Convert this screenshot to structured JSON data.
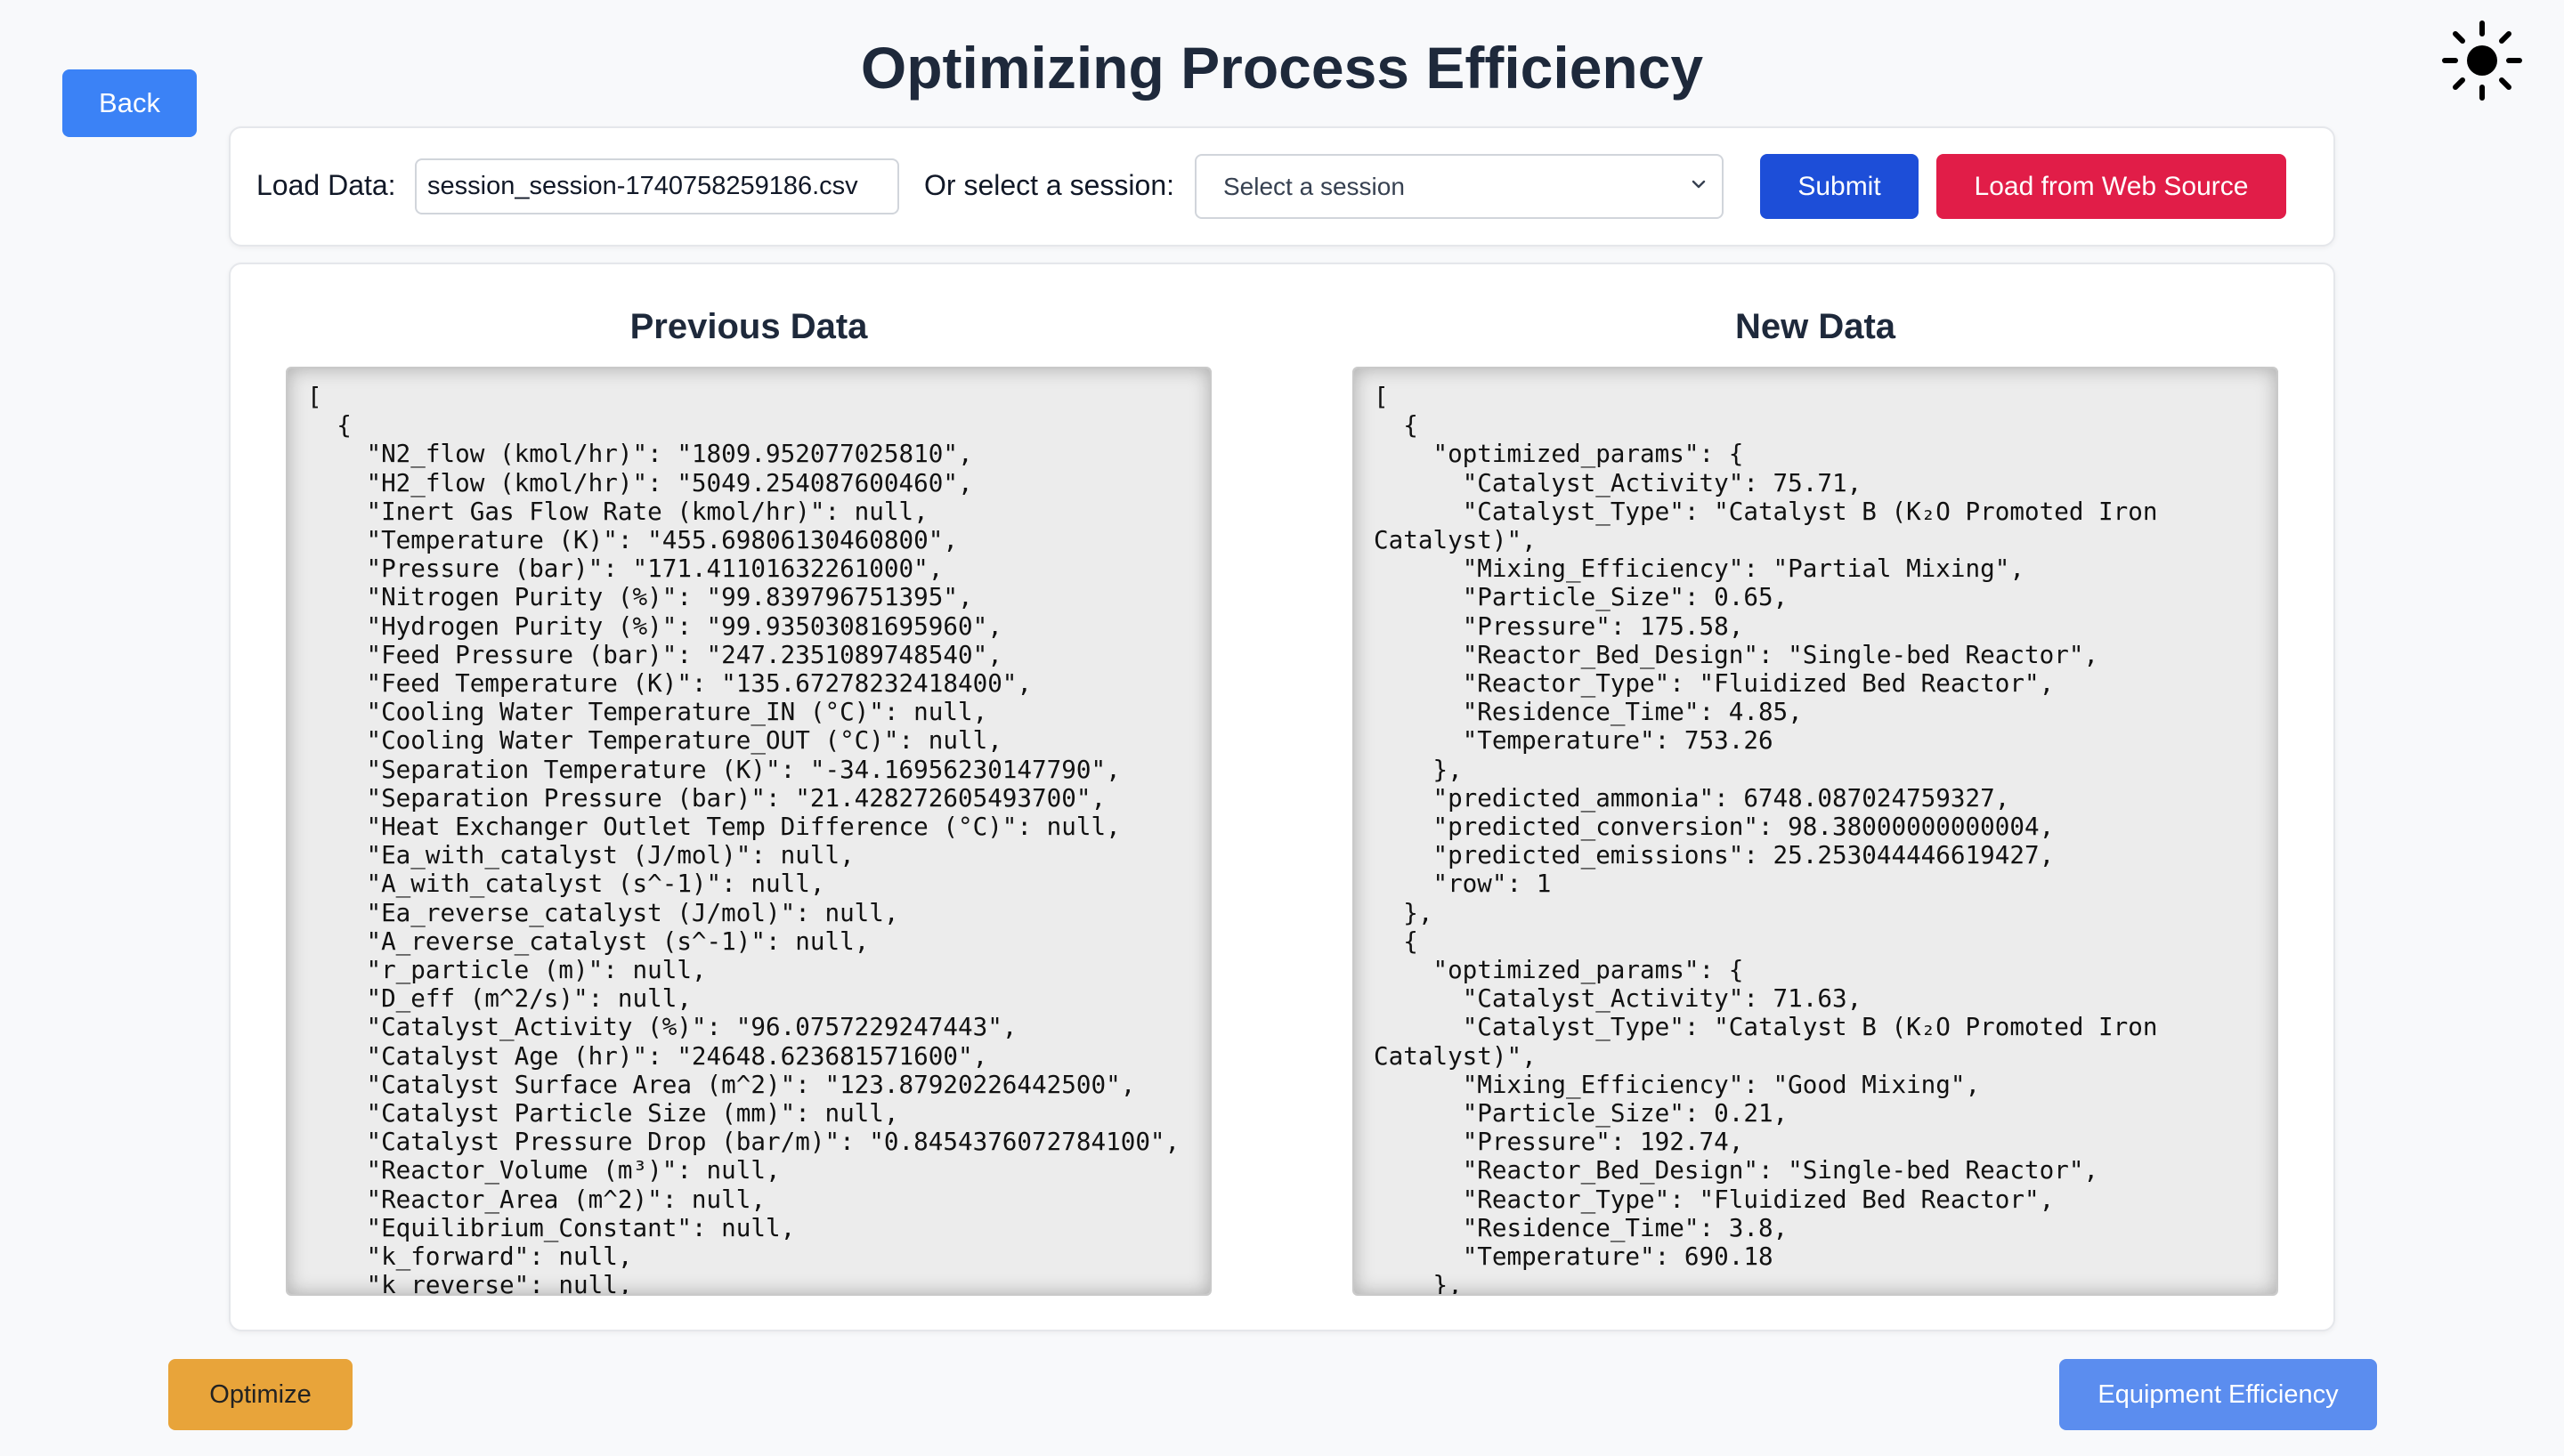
{
  "header": {
    "back_label": "Back",
    "title": "Optimizing Process Efficiency",
    "theme_icon": "sun-icon"
  },
  "load_bar": {
    "load_label": "Load Data:",
    "file_value": "session_session-1740758259186.csv",
    "session_label": "Or select a session:",
    "session_selected": "Select a session",
    "submit_label": "Submit",
    "web_label": "Load from Web Source"
  },
  "panels": {
    "previous_title": "Previous Data",
    "new_title": "New Data",
    "previous_json": "[\n  {\n    \"N2_flow (kmol/hr)\": \"1809.952077025810\",\n    \"H2_flow (kmol/hr)\": \"5049.254087600460\",\n    \"Inert Gas Flow Rate (kmol/hr)\": null,\n    \"Temperature (K)\": \"455.69806130460800\",\n    \"Pressure (bar)\": \"171.41101632261000\",\n    \"Nitrogen Purity (%)\": \"99.839796751395\",\n    \"Hydrogen Purity (%)\": \"99.93503081695960\",\n    \"Feed Pressure (bar)\": \"247.2351089748540\",\n    \"Feed Temperature (K)\": \"135.67278232418400\",\n    \"Cooling Water Temperature_IN (°C)\": null,\n    \"Cooling Water Temperature_OUT (°C)\": null,\n    \"Separation Temperature (K)\": \"-34.16956230147790\",\n    \"Separation Pressure (bar)\": \"21.428272605493700\",\n    \"Heat Exchanger Outlet Temp Difference (°C)\": null,\n    \"Ea_with_catalyst (J/mol)\": null,\n    \"A_with_catalyst (s^-1)\": null,\n    \"Ea_reverse_catalyst (J/mol)\": null,\n    \"A_reverse_catalyst (s^-1)\": null,\n    \"r_particle (m)\": null,\n    \"D_eff (m^2/s)\": null,\n    \"Catalyst_Activity (%)\": \"96.0757229247443\",\n    \"Catalyst Age (hr)\": \"24648.623681571600\",\n    \"Catalyst Surface Area (m^2)\": \"123.87920226442500\",\n    \"Catalyst Particle Size (mm)\": null,\n    \"Catalyst Pressure Drop (bar/m)\": \"0.8454376072784100\",\n    \"Reactor_Volume (m³)\": null,\n    \"Reactor_Area (m^2)\": null,\n    \"Equilibrium_Constant\": null,\n    \"k_forward\": null,\n    \"k_reverse\": null,",
    "new_json": "[\n  {\n    \"optimized_params\": {\n      \"Catalyst_Activity\": 75.71,\n      \"Catalyst_Type\": \"Catalyst B (K₂O Promoted Iron\nCatalyst)\",\n      \"Mixing_Efficiency\": \"Partial Mixing\",\n      \"Particle_Size\": 0.65,\n      \"Pressure\": 175.58,\n      \"Reactor_Bed_Design\": \"Single-bed Reactor\",\n      \"Reactor_Type\": \"Fluidized Bed Reactor\",\n      \"Residence_Time\": 4.85,\n      \"Temperature\": 753.26\n    },\n    \"predicted_ammonia\": 6748.087024759327,\n    \"predicted_conversion\": 98.38000000000004,\n    \"predicted_emissions\": 25.253044446619427,\n    \"row\": 1\n  },\n  {\n    \"optimized_params\": {\n      \"Catalyst_Activity\": 71.63,\n      \"Catalyst_Type\": \"Catalyst B (K₂O Promoted Iron\nCatalyst)\",\n      \"Mixing_Efficiency\": \"Good Mixing\",\n      \"Particle_Size\": 0.21,\n      \"Pressure\": 192.74,\n      \"Reactor_Bed_Design\": \"Single-bed Reactor\",\n      \"Reactor_Type\": \"Fluidized Bed Reactor\",\n      \"Residence_Time\": 3.8,\n      \"Temperature\": 690.18\n    },"
  },
  "footer": {
    "optimize_label": "Optimize",
    "equipment_label": "Equipment Efficiency"
  },
  "colors": {
    "back": "#3b82f6",
    "submit": "#1d4ed8",
    "web_source": "#e11d48",
    "optimize": "#e8a43a",
    "equipment": "#5b8def"
  }
}
